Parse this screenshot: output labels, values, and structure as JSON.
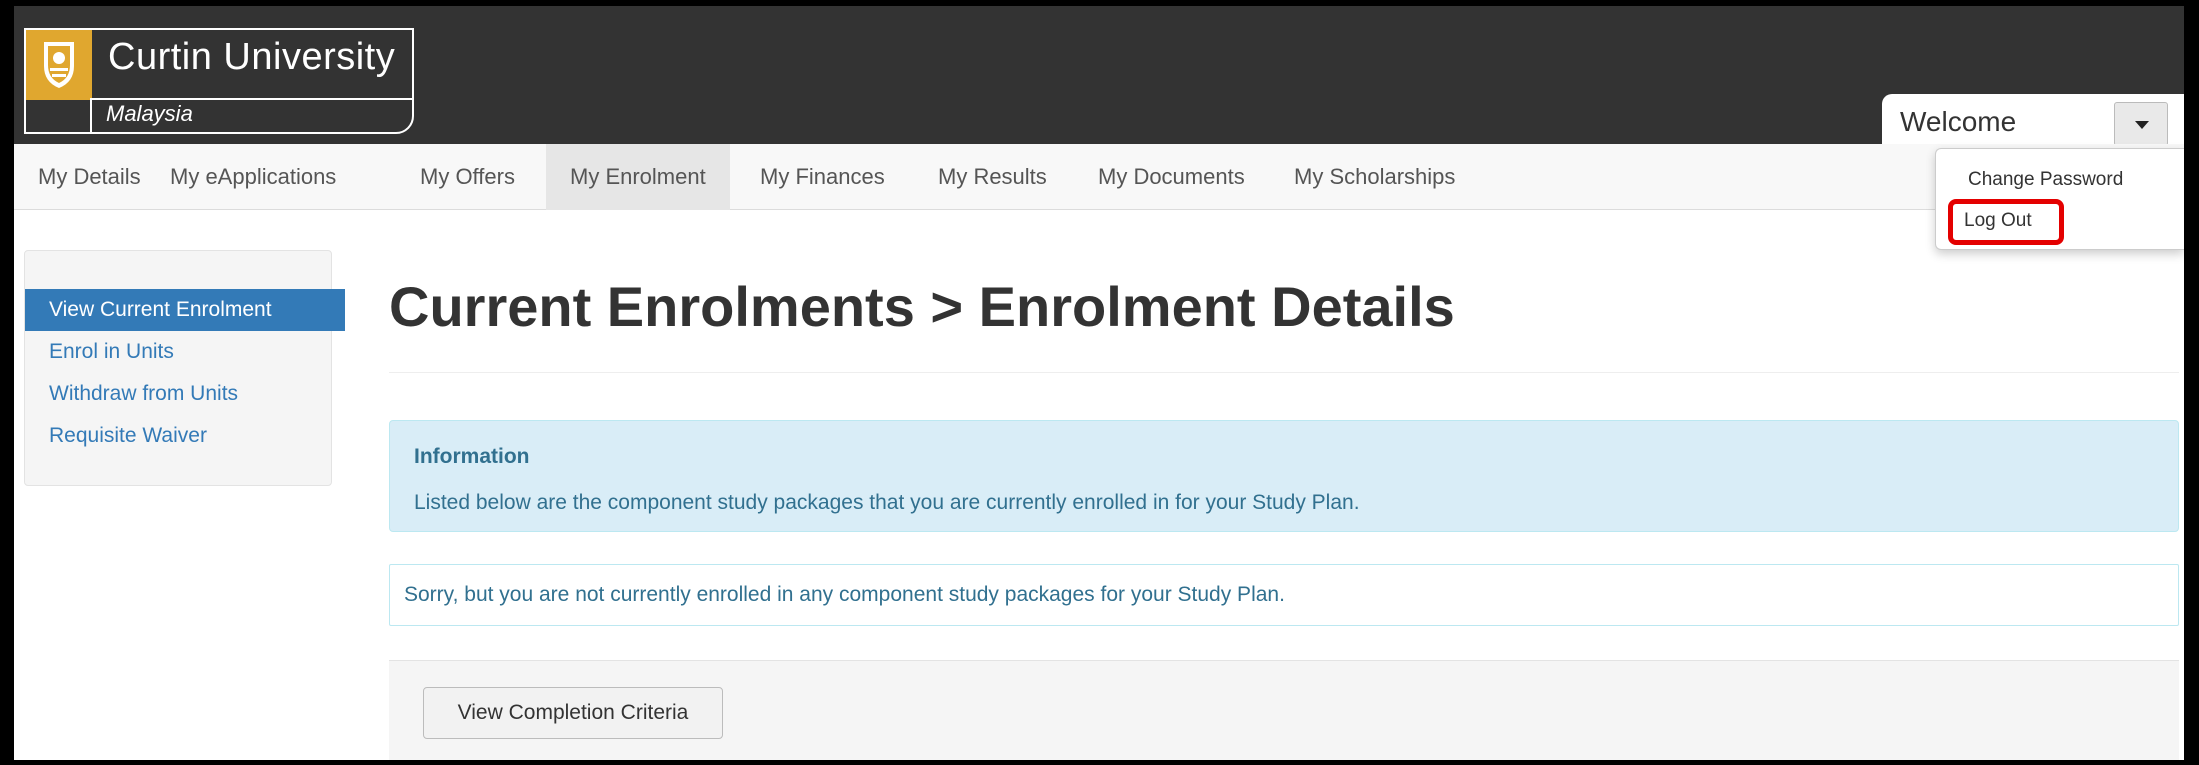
{
  "brand": {
    "name": "Curtin University",
    "campus": "Malaysia",
    "accent": "#e0a72f"
  },
  "user_menu": {
    "welcome": "Welcome",
    "items": [
      "Change Password",
      "Log Out"
    ],
    "highlight_color": "#e40000"
  },
  "nav": {
    "items": [
      "My Details",
      "My eApplications",
      "My Offers",
      "My Enrolment",
      "My Finances",
      "My Results",
      "My Documents",
      "My Scholarships"
    ],
    "active": "My Enrolment"
  },
  "sidebar": {
    "items": [
      "View Current Enrolment",
      "Enrol in Units",
      "Withdraw from Units",
      "Requisite Waiver"
    ],
    "active": "View Current Enrolment",
    "link_color": "#337ab7"
  },
  "main": {
    "title": "Current Enrolments > Enrolment Details",
    "info": {
      "title": "Information",
      "text": "Listed below are the component study packages that you are currently enrolled in for your Study Plan."
    },
    "notice": "Sorry, but you are not currently enrolled in any component study packages for your Study Plan.",
    "completion_button": "View Completion Criteria"
  }
}
